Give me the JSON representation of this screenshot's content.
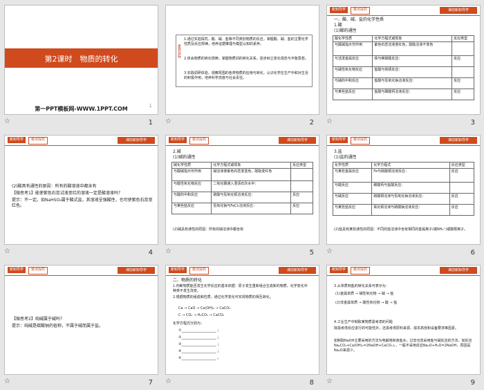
{
  "slides": [
    {
      "num": "1",
      "title": "第2课时　物质的转化",
      "subtitle": "第一PPT模板网-WWW.1PPT.COM",
      "mark": "1"
    },
    {
      "num": "2",
      "side_label": "素养目标",
      "lines": [
        "1.通过实验探究，酸、碱、盐等不同类别物质的反应，掌握酸、碱、盐的主要化学性质及反应规律，培养证据推理与模型认知的素养。",
        "2.体会物质的转化规律，掌握物质间的转化关系，逐步树立变化观念与平衡思想。",
        "3.实践调研体验，观察周围的各类物质的应用与转化，认识化学在生产中和对生活的积极作用，培养科学态度与社会责任。"
      ]
    },
    {
      "num": "3",
      "tab1": "新知导学",
      "tab2": "要点探究",
      "tag": "课前新知导学",
      "section": "一、酸、碱、盐的化学性质",
      "sub": "1.酸",
      "sub2": "(1)酸的通性",
      "head": [
        "酸化学性质",
        "化学方程式或现象",
        "反应类型"
      ],
      "rows": [
        [
          "与酸碱指示剂作用",
          "紫色石蕊溶液变红色，酚酞溶液不变色",
          ""
        ],
        [
          "与活泼金属反应",
          "铁与稀硫酸反应：",
          "反应"
        ],
        [
          "与碱性氧化物反应",
          "盐酸与铁锈反应：",
          ""
        ],
        [
          "与碱的中和反应",
          "盐酸与氢氧化钠溶液反应：",
          "反应"
        ],
        [
          "与某些盐反应",
          "盐酸与碳酸钙溶液反应：",
          "反应"
        ]
      ]
    },
    {
      "num": "4",
      "tab1": "新知导学",
      "tab2": "要点探究",
      "tag": "课前新知导学",
      "l1": "(2)酸具有通性的原因：所有的酸溶液中都含有",
      "l2": "【微思考1】能使紫色石蕊试液变红的溶液一定是酸溶液吗？",
      "l3": "提示：不一定。如NaHSO₄属于酸式盐，其溶液呈强酸性，也可使紫色石蕊变红色。"
    },
    {
      "num": "5",
      "tab1": "新知导学",
      "tab2": "要点探究",
      "tag": "课前新知导学",
      "sub": "2.碱",
      "sub2": "(1)碱的通性",
      "head": [
        "碱化学性质",
        "化学方程式或现象",
        "反应类型"
      ],
      "rows": [
        [
          "与酸碱指示剂作用",
          "碱溶液使紫色石蕊变蓝色，酚酞变红色",
          ""
        ],
        [
          "与酸性氧化物反应",
          "二氧化碳通入澄清石灰水中：",
          ""
        ],
        [
          "与酸的中和反应",
          "硫酸与氢氧化钡溶液反应：",
          "反应"
        ],
        [
          "与某些盐反应",
          "氢氧化钠与FeCl₃溶液反应：",
          "反应"
        ]
      ],
      "foot": "(2)碱具有通性的原因：所有的碱溶液中都含有"
    },
    {
      "num": "6",
      "tab1": "新知导学",
      "tab2": "要点探究",
      "tag": "课前新知导学",
      "sub": "3.盐",
      "sub2": "(1)盐的通性",
      "head": [
        "化学性质",
        "化学方程式",
        "反应类型"
      ],
      "rows": [
        [
          "与某些金属反应",
          "Fe与硫酸铜溶液反应：",
          "反应"
        ],
        [
          "与酸反应",
          "碳酸钙与盐酸反应：",
          ""
        ],
        [
          "与碱反应",
          "硫酸铜溶液与氢氧化钠溶液反应：",
          "反应"
        ],
        [
          "与某些盐反应",
          "氯化钡溶液与硫酸钠溶液反应：",
          "反应"
        ]
      ],
      "foot": "(2)盐具有某些通性的原因：不同的盐溶液中含有相同的金属离子(或NH₄⁺)或酸根离子。"
    },
    {
      "num": "7",
      "tab1": "新知导学",
      "tab2": "要点探究",
      "tag": "课前新知导学",
      "l1": "【微思考2】纯碱属于碱吗？",
      "l2": "提示：纯碱是碳酸钠的俗称，不属于碱而属于盐。"
    },
    {
      "num": "8",
      "tab1": "新知导学",
      "tab2": "要点探究",
      "tag": "课前新知导学",
      "section": "二、物质的转化",
      "l1": "1.判断物质能否发生化学反应的基本依据：原子发生重新组合生成新的物质，化学变化中　　　种类不发生改变。",
      "l2": "2.根据物质的组成和性质，通过化学变化可实现物质的相互转化。",
      "chain": [
        "Ca",
        "CaO",
        "Ca(OH)₂",
        "CaCO₃"
      ],
      "chain2": [
        "C",
        "CO₂",
        "H₂CO₃",
        "CaCO₃"
      ],
      "l3": "化学方程式分别为："
    },
    {
      "num": "9",
      "tab1": "新知导学",
      "tab2": "要点探究",
      "tag": "课前新知导学",
      "l1": "3.从单质到盐的转化关系可表示为：",
      "m1": "(1)金属单质",
      "m2": "碱性氧化物",
      "m3": "碱",
      "m4": "盐",
      "n1": "(2)非金属单质",
      "n2": "酸性氧化物",
      "n3": "酸",
      "n4": "盐",
      "l2": "4.工业生产中制取某物质需考虑的问题",
      "l3": "除需考虑反应进行的可能性外，还需考虑原料来源、成本高低和设备要求等因素。",
      "l4": "如制取NaOH主要采用的方法为电解饱和食盐水，过去也曾采用盐与碱反应的方法，如反应Na₂CO₃+Ca(OH)₂=2NaOH+CaCO₃↓，一般不采用反应Na₂O+H₂O=2NaOH，原因是Na₂O来源少。"
    }
  ]
}
